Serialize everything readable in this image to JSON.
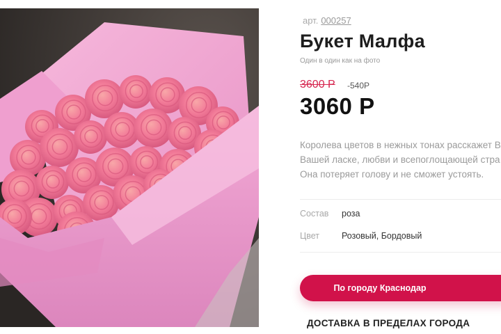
{
  "product": {
    "sku_label": "арт.",
    "sku_number": "000257",
    "title": "Букет Малфа",
    "subtitle": "Один в один как на фото",
    "old_price": "3600 Р",
    "discount": "-540Р",
    "price": "3060 Р",
    "description": [
      "Королева цветов в нежных тонах расскажет В",
      "Вашей ласке, любви и всепоглощающей стра",
      "Она потеряет голову и не сможет устоять."
    ],
    "attributes": [
      {
        "label": "Состав",
        "value": "роза"
      },
      {
        "label": "Цвет",
        "value": "Розовый, Бордовый"
      }
    ]
  },
  "actions": {
    "city_button": "По городу Краснодар",
    "delivery_label": "ДОСТАВКА В ПРЕДЕЛАХ ГОРОДА"
  },
  "colors": {
    "accent": "#d1124a",
    "old_price": "#d6264f",
    "wrap_paper": "#f1a7d2",
    "roses": "#f27a98"
  },
  "photo": {
    "subject": "bouquet-of-pink-roses-in-pink-wrapping"
  }
}
